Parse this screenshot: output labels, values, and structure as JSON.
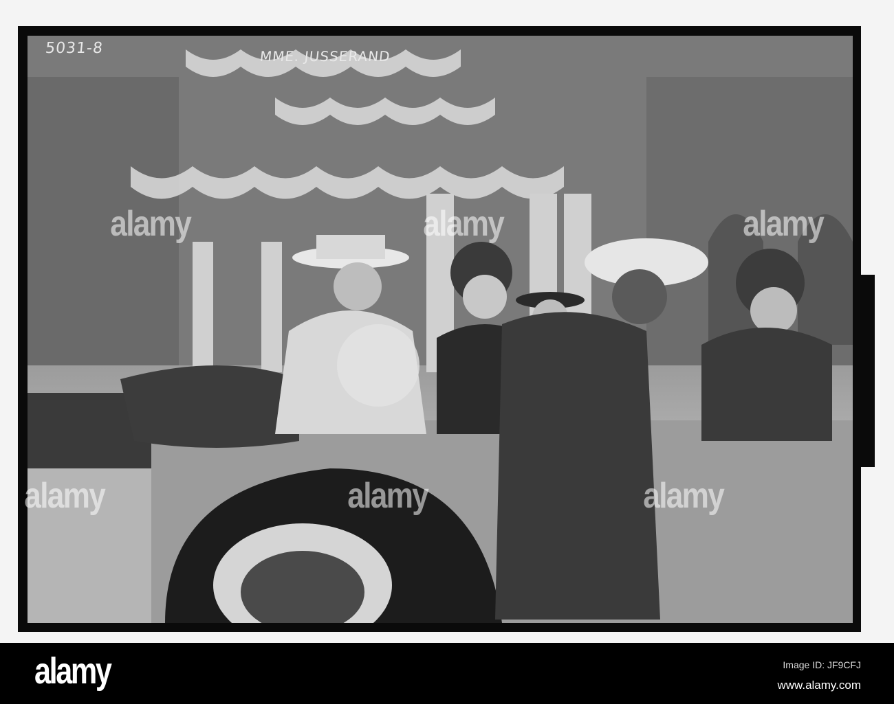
{
  "photo": {
    "negative_number": "5031-8",
    "caption": "MME. JUSSERAND"
  },
  "watermark": {
    "text": "alamy"
  },
  "footer": {
    "logo": "alamy",
    "image_id": "Image ID: JF9CFJ",
    "url": "www.alamy.com"
  }
}
